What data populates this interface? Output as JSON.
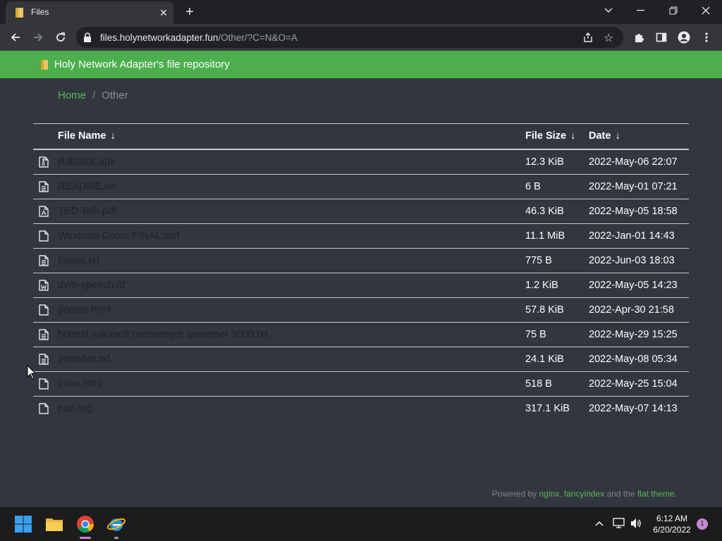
{
  "browser": {
    "tab_title": "Files",
    "tab_close": "✕",
    "new_tab": "+",
    "url_host": "files.holynetworkadapter.fun",
    "url_path": "/Other/?C=N&O=A"
  },
  "site": {
    "title": "Holy Network Adapter's file repository"
  },
  "breadcrumb": {
    "home": "Home",
    "separator": "/",
    "current": "Other"
  },
  "table": {
    "headers": {
      "name": "File Name",
      "size": "File Size",
      "date": "Date",
      "sort_arrow": "↓"
    },
    "rows": [
      {
        "name": "Ballsack.apk",
        "size": "12.3 KiB",
        "date": "2022-May-06 22:07",
        "icon": "archive-file-icon"
      },
      {
        "name": "README.txt",
        "size": "6 B",
        "date": "2022-May-01 07:21",
        "icon": "text-file-icon"
      },
      {
        "name": "TED Talk.pdf",
        "size": "46.3 KiB",
        "date": "2022-May-05 18:58",
        "icon": "pdf-file-icon"
      },
      {
        "name": "Windows Doors FINAL.swf",
        "size": "11.1 MiB",
        "date": "2022-Jan-01 14:43",
        "icon": "file-icon"
      },
      {
        "name": "based.txt",
        "size": "775 B",
        "date": "2022-Jun-03 18:03",
        "icon": "text-file-icon"
      },
      {
        "name": "dvm-speech.rtf",
        "size": "1.2 KiB",
        "date": "2022-May-05 14:23",
        "icon": "word-file-icon"
      },
      {
        "name": "goatse.html",
        "size": "57.8 KiB",
        "date": "2022-Apr-30 21:58",
        "icon": "file-icon"
      },
      {
        "name": "hottest mikasoft messenger spammer 9000.txt",
        "size": "75 B",
        "date": "2022-May-29 15:25",
        "icon": "text-file-icon"
      },
      {
        "name": "janusbot.txt",
        "size": "24.1 KiB",
        "date": "2022-May-08 05:34",
        "icon": "text-file-icon"
      },
      {
        "name": "lmao.html",
        "size": "518 B",
        "date": "2022-May-25 15:04",
        "icon": "file-icon"
      },
      {
        "name": "piss.log",
        "size": "317.1 KiB",
        "date": "2022-May-07 14:13",
        "icon": "file-icon"
      }
    ]
  },
  "footer": {
    "prefix": "Powered by ",
    "nginx": "nginx",
    "comma": ", ",
    "fancyindex": "fancyindex",
    "and_the": " and the ",
    "flat_theme": "flat theme",
    "suffix": "."
  },
  "taskbar": {
    "time": "6:12 AM",
    "date": "6/20/2022",
    "notification_count": "1"
  },
  "colors": {
    "header_green": "#4cae4c",
    "link_green": "#5cb85c",
    "page_bg": "#32363f"
  }
}
